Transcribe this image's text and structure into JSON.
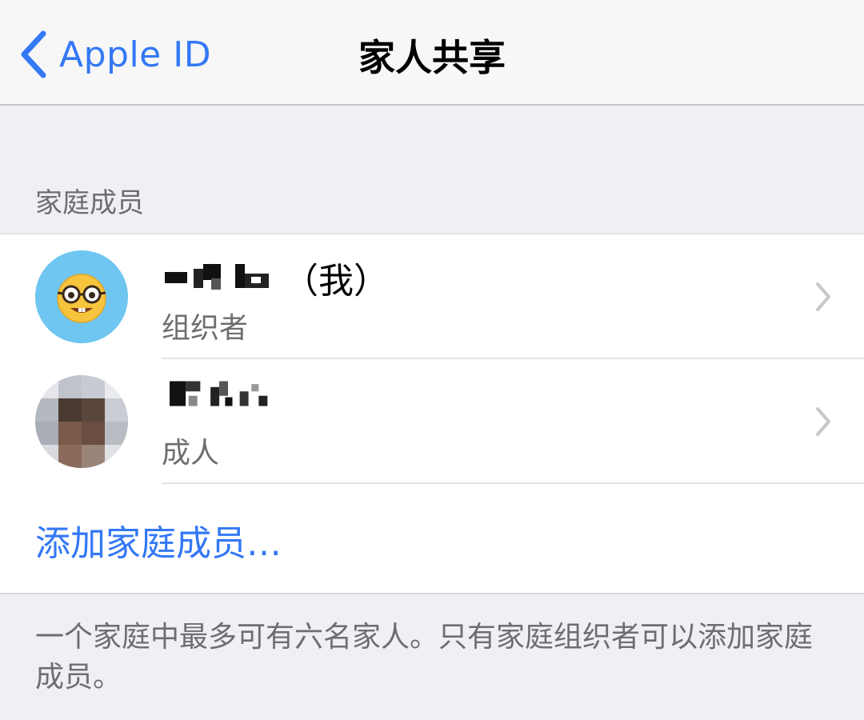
{
  "navbar": {
    "back_label": "Apple ID",
    "title": "家人共享"
  },
  "section": {
    "header": "家庭成员"
  },
  "members": [
    {
      "name_suffix": "（我）",
      "role": "组织者",
      "avatar": "nerd-face-emoji"
    },
    {
      "name_suffix": "",
      "role": "成人",
      "avatar": "pixelated-photo"
    }
  ],
  "add_member_label": "添加家庭成员…",
  "footer": "一个家庭中最多可有六名家人。只有家庭组织者可以添加家庭成员。",
  "colors": {
    "accent": "#3478f6",
    "background": "#efeff4",
    "secondary_text": "#6d6d72"
  }
}
